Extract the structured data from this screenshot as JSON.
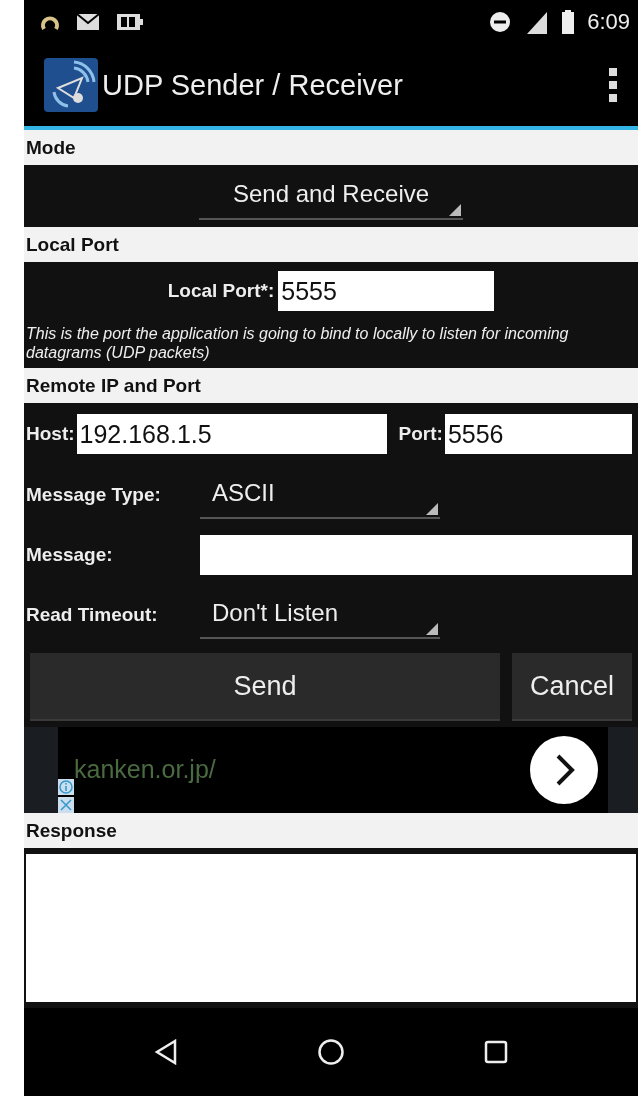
{
  "status_bar": {
    "time": "6:09"
  },
  "app_bar": {
    "title": "UDP Sender / Receiver"
  },
  "mode": {
    "header": "Mode",
    "value": "Send and Receive"
  },
  "local_port": {
    "header": "Local Port",
    "label": "Local Port*:",
    "value": "5555",
    "description": "This is the port the application is going to bind to locally to listen for incoming datagrams (UDP packets)"
  },
  "remote": {
    "header": "Remote IP and Port",
    "host_label": "Host:",
    "host_value": "192.168.1.5",
    "port_label": "Port:",
    "port_value": "5556"
  },
  "message_type": {
    "label": "Message Type:",
    "value": "ASCII"
  },
  "message": {
    "label": "Message:"
  },
  "read_timeout": {
    "label": "Read Timeout:",
    "value": "Don't Listen"
  },
  "buttons": [
    {
      "label": "Send"
    },
    {
      "label": "Cancel"
    }
  ],
  "ad": {
    "text": "kanken.or.jp/"
  },
  "response": {
    "header": "Response"
  }
}
